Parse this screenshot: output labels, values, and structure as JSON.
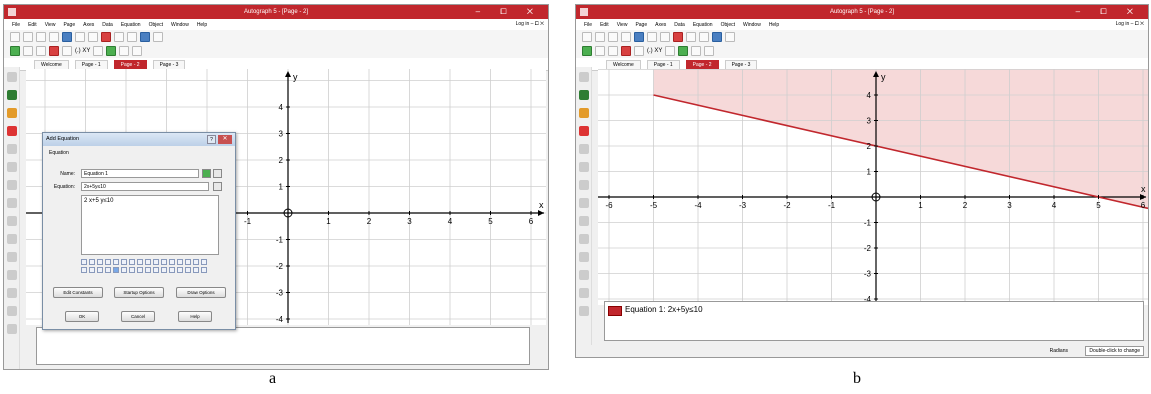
{
  "window": {
    "title": "Autograph 5 - [Page - 2]",
    "controls": "– ⧠ ✕",
    "menu": [
      "File",
      "Edit",
      "View",
      "Page",
      "Axes",
      "Data",
      "Equation",
      "Object",
      "Window",
      "Help"
    ],
    "login": "Log in  – ⧠ ✕",
    "tabs": [
      "Welcome",
      "Page - 1",
      "Page - 2",
      "Page - 3"
    ],
    "tabs_scroll": "‹ › ×",
    "toolbar_text": "(.) XY"
  },
  "panel_a": {
    "caption": "a",
    "axes": {
      "x_label": "x",
      "y_label": "y",
      "x_ticks": [
        "-1",
        "1",
        "2",
        "3",
        "4",
        "5",
        "6"
      ],
      "y_ticks": [
        "4",
        "3",
        "2",
        "1",
        "-1",
        "-2",
        "-3",
        "-4"
      ]
    },
    "dialog": {
      "title": "Add Equation",
      "close": "✕",
      "help": "?",
      "group_label": "Equation",
      "name_label": "Name:",
      "name_value": "Equation 1",
      "equation_label": "Equation:",
      "equation_value": "2x+5y≤10",
      "preview": "2 x+5 y≤10",
      "buttons": {
        "edit_constants": "Edit Constants",
        "startup_options": "Startup Options",
        "draw_options": "Draw Options",
        "ok": "OK",
        "cancel": "Cancel",
        "help": "Help"
      }
    }
  },
  "panel_b": {
    "caption": "b",
    "axes": {
      "x_label": "x",
      "y_label": "y",
      "x_ticks": [
        "-6",
        "-5",
        "-4",
        "-3",
        "-2",
        "-1",
        "1",
        "2",
        "3",
        "4",
        "5",
        "6"
      ],
      "y_ticks": [
        "4",
        "3",
        "2",
        "1",
        "-1",
        "-2",
        "-3",
        "-4"
      ]
    },
    "legend": "Equation 1: 2x+5y≤10",
    "status": {
      "unit": "Radians",
      "hint": "Double-click to change"
    },
    "colors": {
      "line": "#c1272d",
      "shade": "#f6d9d9"
    }
  }
}
